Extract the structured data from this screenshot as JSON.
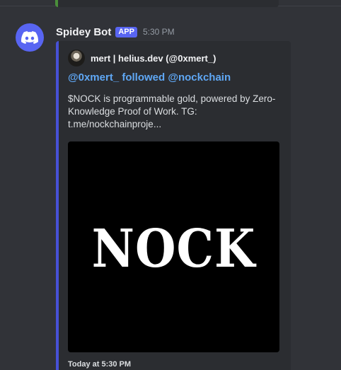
{
  "message": {
    "username": "Spidey Bot",
    "badge": "APP",
    "timestamp": "5:30 PM",
    "avatar_icon": "discord-logo-icon"
  },
  "embed": {
    "author": "mert | helius.dev (@0xmert_)",
    "title": "@0xmert_ followed @nockchain",
    "description": "$NOCK is programmable gold, powered by Zero-Knowledge Proof of Work. TG: t.me/nockchainproje...",
    "image_text": "NOCK",
    "footer": "Today at 5:30 PM"
  },
  "colors": {
    "background": "#313338",
    "embed_background": "#2b2d31",
    "embed_accent": "#4751d6",
    "prev_embed_accent": "#4a8f3a",
    "badge": "#5865f2",
    "link": "#5fa7f4"
  }
}
